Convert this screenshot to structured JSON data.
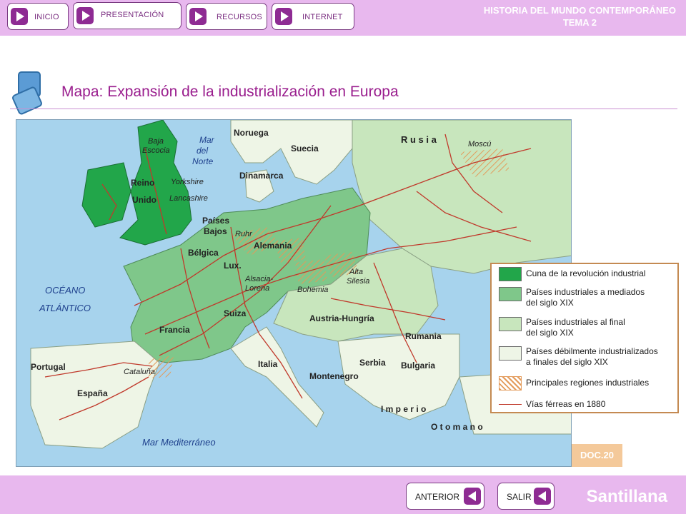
{
  "nav": {
    "items": [
      {
        "label": "INICIO"
      },
      {
        "label": "PRESENTACIÓN"
      },
      {
        "label": "RECURSOS"
      },
      {
        "label": "INTERNET"
      }
    ]
  },
  "header": {
    "line1": "HISTORIA DEL MUNDO CONTEMPORÁNEO",
    "line2": "TEMA 2"
  },
  "page": {
    "title": "Mapa: Expansión de la industrialización en Europa"
  },
  "map": {
    "labels": {
      "mar_del_norte": [
        "Mar",
        "del",
        "Norte"
      ],
      "noruega": "Noruega",
      "suecia": "Suecia",
      "dinamarca": "Dinamarca",
      "rusia": "R u s i a",
      "moscu": "Moscú",
      "baja_escocia": [
        "Baja",
        "Escocia"
      ],
      "reino_unido": [
        "Reino",
        "Unido"
      ],
      "yorkshire": "Yorkshire",
      "lancashire": "Lancashire",
      "paises_bajos": [
        "Países",
        "Bajos"
      ],
      "ruhr": "Ruhr",
      "belgica": "Bélgica",
      "alemania": "Alemania",
      "lux": "Lux.",
      "alsacia_lorena": [
        "Alsacia-",
        "Lorena"
      ],
      "alta_silesia": [
        "Alta",
        "Silesia"
      ],
      "bohemia": "Bohemia",
      "oceano_atlantico": [
        "OCÉANO",
        "ATLÁNTICO"
      ],
      "suiza": "Suiza",
      "francia": "Francia",
      "austria_hungria": "Austria-Hungría",
      "rumania": "Rumania",
      "portugal": "Portugal",
      "cataluna": "Cataluña",
      "italia": "Italia",
      "serbia": "Serbia",
      "bulgaria": "Bulgaria",
      "montenegro": "Montenegro",
      "espana": "España",
      "imperio": "I m p e r i o",
      "otomano": "O t o m a n o",
      "mar_mediterraneo": "Mar  Mediterráneo"
    },
    "colors": {
      "sea": "#a7d3ed",
      "cradle": "#22a64a",
      "mid_century": "#7fc78a",
      "late_century": "#c8e6bd",
      "weak": "#eef5e6",
      "railway": "#c0392b",
      "industrial_hatch": "#e39a5a"
    }
  },
  "legend": {
    "items": [
      {
        "text": [
          "Cuna de la revolución industrial"
        ]
      },
      {
        "text": [
          "Países industriales a mediados",
          "del siglo XIX"
        ]
      },
      {
        "text": [
          "Países industriales al final",
          "del siglo XIX"
        ]
      },
      {
        "text": [
          "Países débilmente industrializados",
          "a finales del siglo XIX"
        ]
      },
      {
        "text": [
          "Principales regiones industriales"
        ]
      },
      {
        "text": [
          "Vías férreas en 1880"
        ]
      }
    ]
  },
  "doc_badge": "DOC.20",
  "footer": {
    "prev_label": "ANTERIOR",
    "exit_label": "SALIR",
    "brand": "Santillana"
  }
}
